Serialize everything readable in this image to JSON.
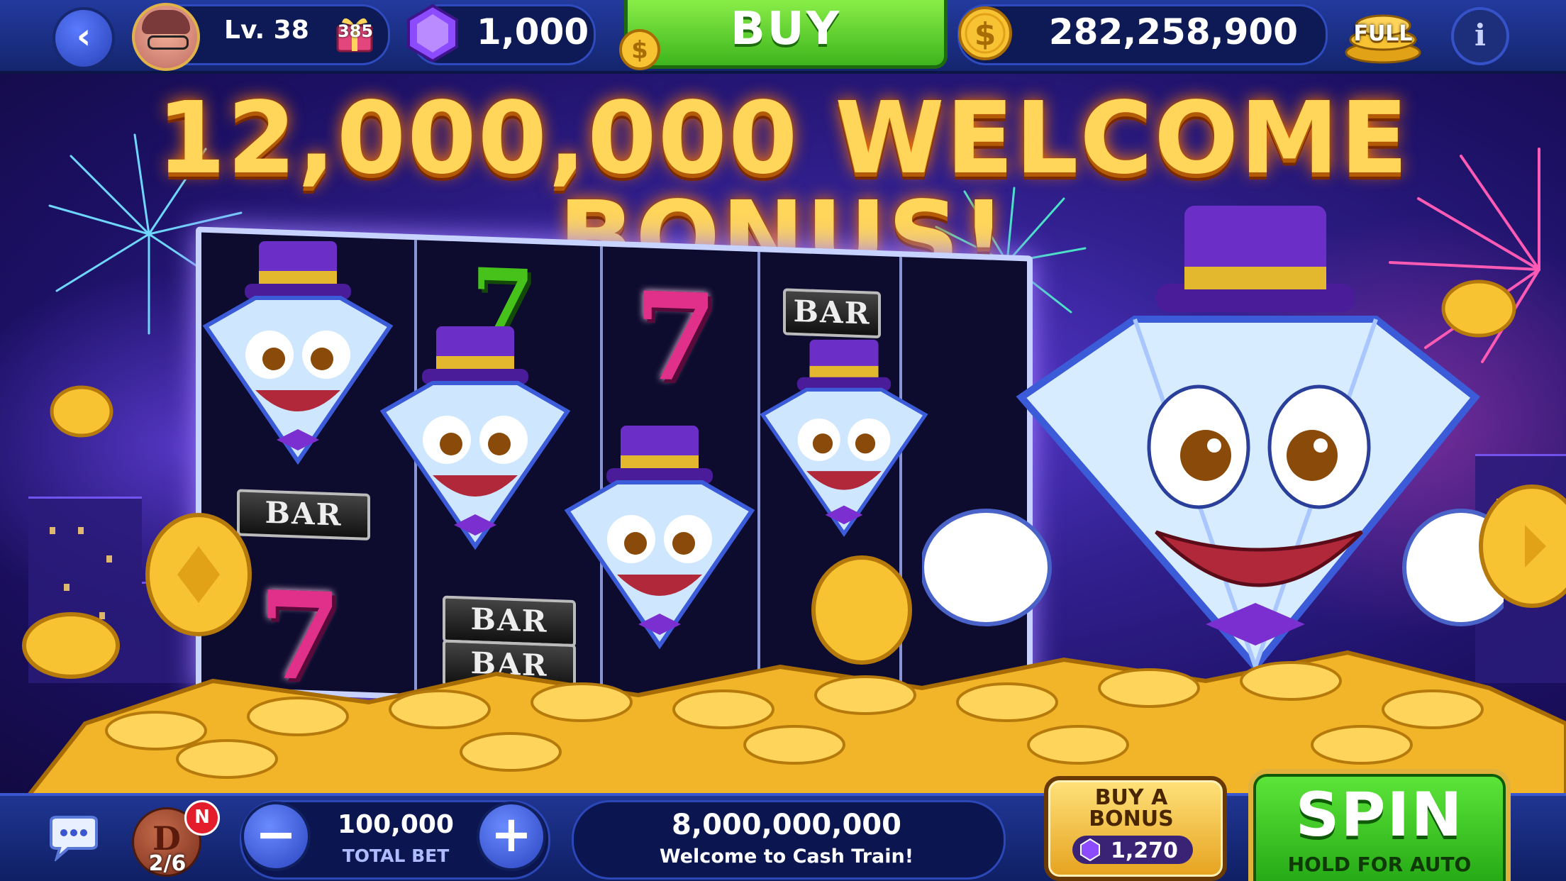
{
  "top_bar": {
    "level_label": "Lv. 38",
    "gift_count": "385",
    "gems_balance": "1,000",
    "buy_label": "BUY",
    "coins_balance": "282,258,900",
    "full_label": "FULL",
    "info_label": "i"
  },
  "banner": {
    "headline": "12,000,000 WELCOME BONUS!",
    "reel_symbols": {
      "bar": "BAR",
      "seven": "7"
    }
  },
  "bottom_bar": {
    "stamp_progress": "2/6",
    "stamp_badge": "N",
    "minus_label": "−",
    "plus_label": "+",
    "total_bet_value": "100,000",
    "total_bet_label": "TOTAL BET",
    "jackpot_value": "8,000,000,000",
    "jackpot_message": "Welcome to Cash Train!",
    "buy_bonus_label_line1": "BUY A",
    "buy_bonus_label_line2": "BONUS",
    "buy_bonus_price": "1,270",
    "spin_label": "SPIN",
    "spin_sublabel": "HOLD FOR AUTO"
  },
  "colors": {
    "top_bar": "#1b2f86",
    "buy_green": "#4cc72a",
    "gold": "#f5b82a",
    "headline": "#ffd65a",
    "spin_green": "#3fcf24",
    "background": "#2b1a80"
  }
}
